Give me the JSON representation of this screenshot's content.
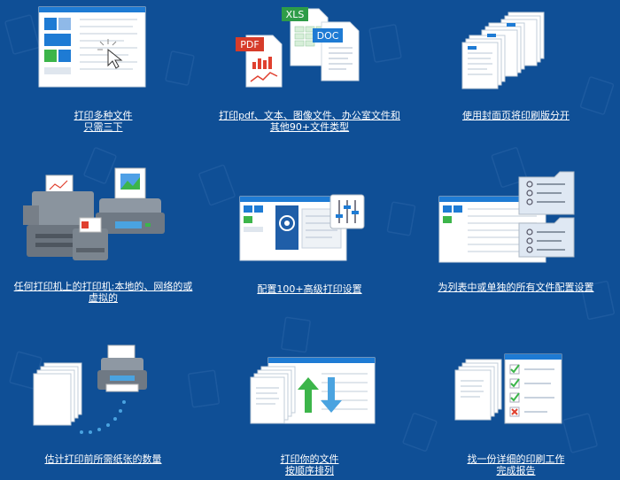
{
  "features": [
    {
      "id": "multi-files",
      "icon": "cursor-window-icon",
      "lines": [
        "打印多种文件",
        "只需三下"
      ]
    },
    {
      "id": "file-types",
      "icon": "file-types-icon",
      "lines": [
        "打印pdf、文本、图像文件、办公室文件和",
        "其他90+文件类型"
      ],
      "badges": [
        "PDF",
        "XLS",
        "DOC"
      ]
    },
    {
      "id": "cover-pages",
      "icon": "cover-pages-icon",
      "lines": [
        "使用封面页将印刷版分开"
      ]
    },
    {
      "id": "any-printer",
      "icon": "printers-icon",
      "lines": [
        "任何打印机上的打印机:本地的、网络的或",
        "虚拟的"
      ]
    },
    {
      "id": "settings",
      "icon": "settings-window-icon",
      "lines": [
        "配置100+高级打印设置"
      ]
    },
    {
      "id": "per-file",
      "icon": "per-file-settings-icon",
      "lines": [
        "为列表中或单独的所有文件配置设置"
      ]
    },
    {
      "id": "estimate",
      "icon": "paper-count-icon",
      "lines": [
        "估计打印前所需纸张的数量"
      ]
    },
    {
      "id": "order",
      "icon": "sort-order-icon",
      "lines": [
        "打印你的文件",
        "按顺序排列"
      ]
    },
    {
      "id": "report",
      "icon": "report-checklist-icon",
      "lines": [
        "找一份详细的印刷工作",
        "完成报告"
      ]
    }
  ],
  "colors": {
    "background": "#0f4f96",
    "accent_blue": "#1e7bd4",
    "green": "#3cb54a",
    "red": "#e0402f"
  }
}
